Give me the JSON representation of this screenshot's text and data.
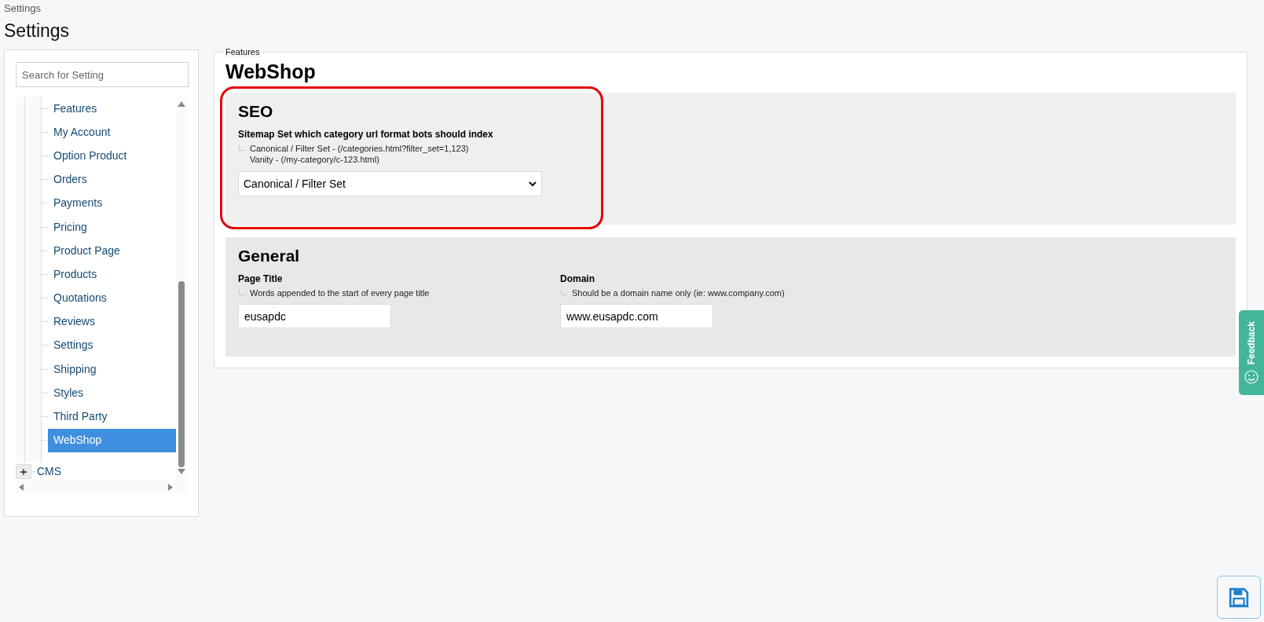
{
  "breadcrumb": "Settings",
  "page_title": "Settings",
  "sidebar": {
    "search": {
      "placeholder": "Search for Setting"
    },
    "items": [
      {
        "label": "Features",
        "selected": false
      },
      {
        "label": "My Account",
        "selected": false
      },
      {
        "label": "Option Product",
        "selected": false
      },
      {
        "label": "Orders",
        "selected": false
      },
      {
        "label": "Payments",
        "selected": false
      },
      {
        "label": "Pricing",
        "selected": false
      },
      {
        "label": "Product Page",
        "selected": false
      },
      {
        "label": "Products",
        "selected": false
      },
      {
        "label": "Quotations",
        "selected": false
      },
      {
        "label": "Reviews",
        "selected": false
      },
      {
        "label": "Settings",
        "selected": false
      },
      {
        "label": "Shipping",
        "selected": false
      },
      {
        "label": "Styles",
        "selected": false
      },
      {
        "label": "Third Party",
        "selected": false
      },
      {
        "label": "WebShop",
        "selected": true
      }
    ],
    "next_node": {
      "label": "CMS",
      "expanded": false
    }
  },
  "panel": {
    "legend": "Features",
    "heading": "WebShop",
    "sections": [
      {
        "title": "SEO",
        "highlighted": true,
        "fields": [
          {
            "kind": "select",
            "label": "Sitemap Set which category url format bots should index",
            "help": [
              "Canonical / Filter Set - (/categories.html?filter_set=1,123)",
              "Vanity - (/my-category/c-123.html)"
            ],
            "value": "Canonical / Filter Set"
          }
        ]
      },
      {
        "title": "General",
        "highlighted": false,
        "fields": [
          {
            "kind": "text",
            "label": "Page Title",
            "help": [
              "Words appended to the start of every page title"
            ],
            "value": "eusapdc"
          },
          {
            "kind": "text",
            "label": "Domain",
            "help": [
              "Should be a domain name only (ie: www.company.com)"
            ],
            "value": "www.eusapdc.com"
          }
        ]
      }
    ]
  },
  "feedback_tab": "Feedback"
}
